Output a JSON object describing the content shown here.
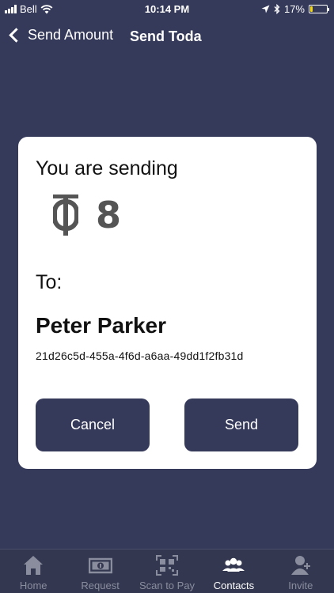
{
  "status_bar": {
    "carrier": "Bell",
    "time": "10:14 PM",
    "battery_percent": "17%",
    "battery_level": 0.17,
    "battery_color": "#f5d90a"
  },
  "nav": {
    "back_label": "Send Amount",
    "title": "Send Toda"
  },
  "card": {
    "sending_label": "You are sending",
    "currency_icon": "toda-currency-icon",
    "amount": "8",
    "to_label": "To:",
    "recipient_name": "Peter Parker",
    "recipient_id": "21d26c5d-455a-4f6d-a6aa-49dd1f2fb31d",
    "cancel_label": "Cancel",
    "send_label": "Send"
  },
  "tab_bar": {
    "items": [
      {
        "label": "Home",
        "icon": "home-icon",
        "active": false
      },
      {
        "label": "Request",
        "icon": "banknote-icon",
        "active": false
      },
      {
        "label": "Scan to Pay",
        "icon": "qr-code-icon",
        "active": false
      },
      {
        "label": "Contacts",
        "icon": "contacts-icon",
        "active": true
      },
      {
        "label": "Invite",
        "icon": "add-user-icon",
        "active": false
      }
    ]
  },
  "colors": {
    "background": "#35395a",
    "card": "#ffffff",
    "button": "#35395a",
    "tab_inactive": "#8a8d9e",
    "tab_active": "#ffffff"
  }
}
